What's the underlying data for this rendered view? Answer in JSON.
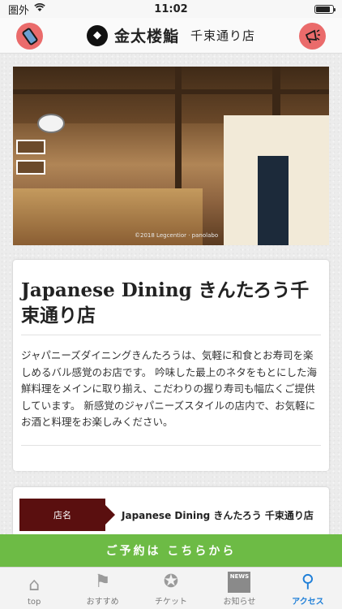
{
  "status_bar": {
    "carrier": "圏外",
    "time": "11:02",
    "battery_level": 0.85
  },
  "header": {
    "brand_mark": "◆",
    "brand_name": "金太楼鮨",
    "branch": "千束通り店",
    "left_icon": "smartphone-icon",
    "right_icon": "megaphone-icon"
  },
  "hero": {
    "credit": "©2018 Legcentior · panolabo"
  },
  "store": {
    "title": "Japanese Dining きんたろう千束通り店",
    "description": "ジャパニーズダイニングきんたろうは、気軽に和食とお寿司を楽しめるバル感覚のお店です。 吟味した最上のネタをもとにした海鮮料理をメインに取り揃え、こだわりの握り寿司も幅広くご提供しています。 新感覚のジャパニーズスタイルの店内で、お気軽にお酒と料理をお楽しみください。"
  },
  "info": {
    "label": "店名",
    "value": "Japanese Dining きんたろう 千束通り店"
  },
  "reserve": {
    "label": "ご予約は こちらから"
  },
  "tabs": [
    {
      "label": "top",
      "icon": "house-icon",
      "glyph": "⌂"
    },
    {
      "label": "おすすめ",
      "icon": "sign-icon",
      "glyph": "⚑"
    },
    {
      "label": "チケット",
      "icon": "ticket-icon",
      "glyph": "✪"
    },
    {
      "label": "お知らせ",
      "icon": "news-icon",
      "glyph": "NEWS"
    },
    {
      "label": "アクセス",
      "icon": "map-pin-icon",
      "glyph": "⚲"
    }
  ],
  "colors": {
    "accent_green": "#6dbb45",
    "label_maroon": "#5a0f0f",
    "active_blue": "#1f7fd8",
    "header_button": "#ea6b6b"
  }
}
